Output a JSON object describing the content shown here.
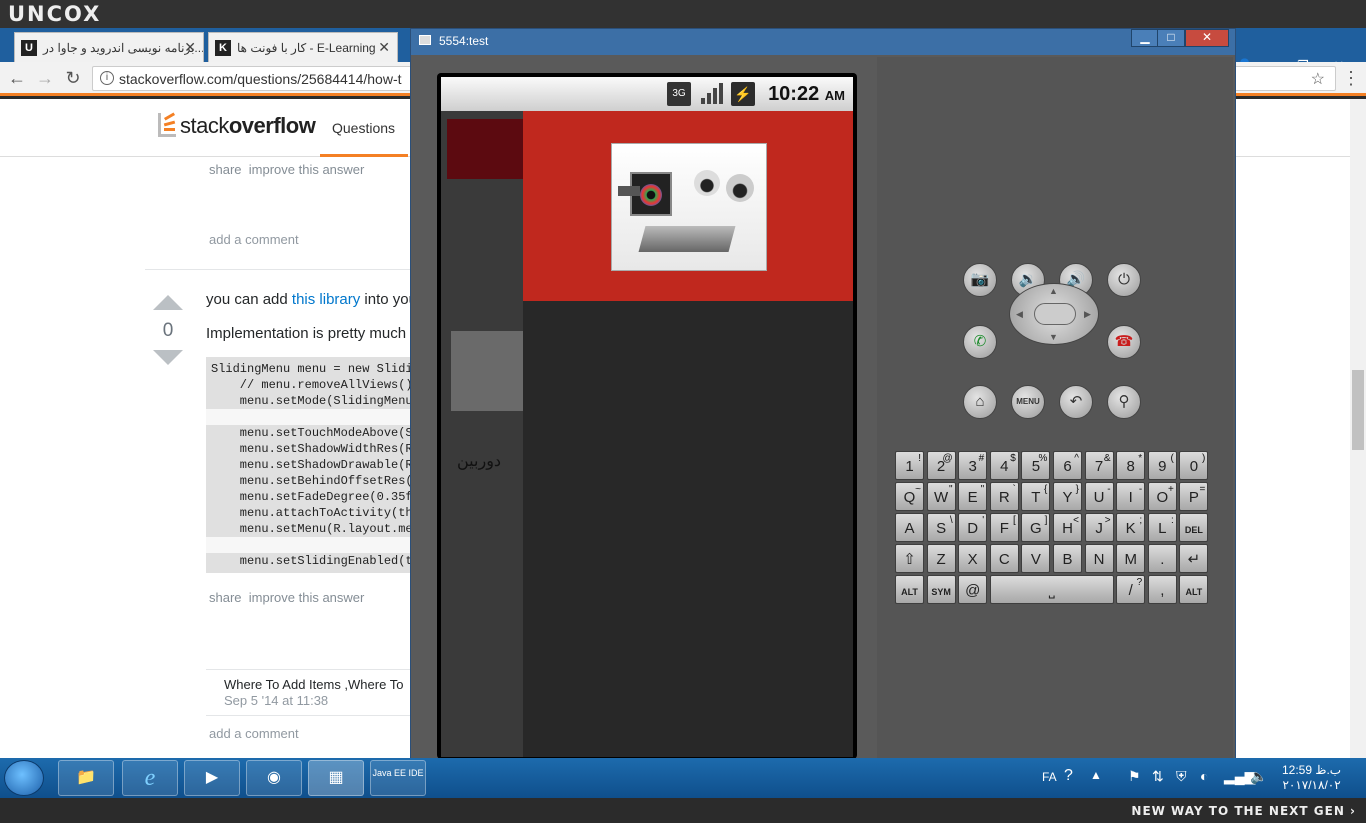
{
  "overlay": {
    "brand": "UNCOX",
    "tagline": "NEW WAY TO THE NEXT GEN ›"
  },
  "browser": {
    "tabs": [
      {
        "icon": "U",
        "label": "برنامه نویسی اندروید و جاوا در..."
      },
      {
        "icon": "K",
        "label": "کار با فونت ها - E-Learning"
      }
    ],
    "url": "stackoverflow.com/questions/25684414/how-t"
  },
  "site": {
    "logo_light": "stack",
    "logo_bold": "overflow",
    "nav_questions": "Questions",
    "share": "share",
    "improve": "improve this answer",
    "add_comment": "add a comment",
    "answer_prefix": "you can add ",
    "answer_link": "this library",
    "answer_suffix": " into you",
    "vote_count": "0",
    "implementation_text": "Implementation is pretty much e",
    "code_lines": [
      "SlidingMenu menu = new Slidi",
      "    // menu.removeAllViews()",
      "    menu.setMode(SlidingMenu",
      "",
      "    menu.setTouchModeAbove(S",
      "    menu.setShadowWidthRes(R",
      "    menu.setShadowDrawable(R",
      "    menu.setBehindOffsetRes(",
      "    menu.setFadeDegree(0.35f",
      "    menu.attachToActivity(th",
      "    menu.setMenu(R.layout.me",
      "",
      "    menu.setSlidingEnabled(t"
    ],
    "comment_text": "Where To Add Items ,Where To",
    "comment_date": "Sep 5 '14 at 11:38"
  },
  "emulator": {
    "title": "5554:test",
    "time": "10:22",
    "ampm": "AM",
    "network": "3G",
    "bg_text": "دوربین",
    "menu_label": "MENU",
    "keyboard_rows": [
      [
        [
          "1",
          "!"
        ],
        [
          "2",
          "@"
        ],
        [
          "3",
          "#"
        ],
        [
          "4",
          "$"
        ],
        [
          "5",
          "%"
        ],
        [
          "6",
          "^"
        ],
        [
          "7",
          "&"
        ],
        [
          "8",
          "*"
        ],
        [
          "9",
          "("
        ],
        [
          "0",
          ")"
        ]
      ],
      [
        [
          "Q",
          "~"
        ],
        [
          "W",
          "\""
        ],
        [
          "E",
          "\""
        ],
        [
          "R",
          "`"
        ],
        [
          "T",
          "{"
        ],
        [
          "Y",
          "}"
        ],
        [
          "U",
          "-"
        ],
        [
          "I",
          "-"
        ],
        [
          "O",
          "+"
        ],
        [
          "P",
          "="
        ]
      ],
      [
        [
          "A",
          ""
        ],
        [
          "S",
          "\\"
        ],
        [
          "D",
          "'"
        ],
        [
          "F",
          "["
        ],
        [
          "G",
          "]"
        ],
        [
          "H",
          "<"
        ],
        [
          "J",
          ">"
        ],
        [
          "K",
          ";"
        ],
        [
          "L",
          ":"
        ],
        [
          "DEL",
          ""
        ]
      ],
      [
        [
          "⇧",
          ""
        ],
        [
          "Z",
          ""
        ],
        [
          "X",
          ""
        ],
        [
          "C",
          ""
        ],
        [
          "V",
          ""
        ],
        [
          "B",
          ""
        ],
        [
          "N",
          ""
        ],
        [
          "M",
          ""
        ],
        [
          ".",
          ""
        ],
        [
          "↵",
          ""
        ]
      ],
      [
        [
          "ALT",
          ""
        ],
        [
          "SYM",
          ""
        ],
        [
          "@",
          ""
        ],
        [
          "",
          ""
        ],
        [
          "",
          ""
        ],
        [
          "",
          ""
        ],
        [
          "",
          ""
        ],
        [
          "/",
          "?"
        ],
        [
          ",",
          ""
        ],
        [
          "ALT",
          ""
        ]
      ]
    ]
  },
  "taskbar": {
    "lang": "FA",
    "time": "12:59 ب.ظ",
    "date": "۲۰۱۷/۱۸/۰۲",
    "java_label": "Java EE IDE"
  }
}
